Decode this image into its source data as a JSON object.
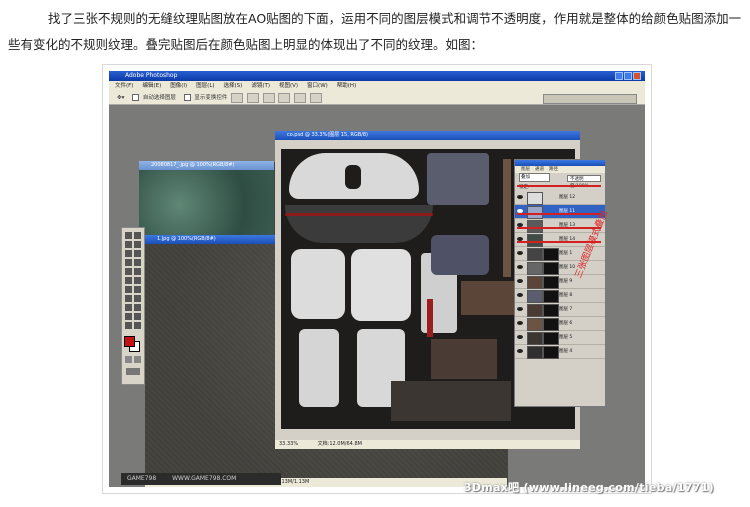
{
  "article": {
    "paragraph": "找了三张不规则的无缝纹理贴图放在AO贴图的下面，运用不同的图层模式和调节不透明度，作用就是整体的给颜色贴图添加一些有变化的不规则纹理。叠完贴图后在颜色贴图上明显的体现出了不同的纹理。如图："
  },
  "photoshop": {
    "app_title": "Adobe Photoshop",
    "menu": [
      "文件(F)",
      "编辑(E)",
      "图像(I)",
      "图层(L)",
      "选择(S)",
      "滤镜(T)",
      "视图(V)",
      "窗口(W)",
      "帮助(H)"
    ],
    "options_bar": {
      "auto_select": "自动选择图层",
      "show_transform": "显示变换控件"
    },
    "documents": [
      {
        "title": "20080817_.jpg @ 100%(RGB/8#)"
      },
      {
        "title": "1.jpg @ 100%(RGB/8#)"
      },
      {
        "title": "co.psd @ 33.3%(图层 15, RGB/8)"
      }
    ],
    "main_status": {
      "zoom": "33.33%",
      "doc_size": "文档:12.0M/64.8M"
    },
    "back_status": "文档:1.13M/1.13M",
    "layers_panel": {
      "tabs": [
        "图层",
        "通道",
        "路径"
      ],
      "blend_mode": "叠加",
      "opacity_label": "不透明度:",
      "opacity_value": "100%",
      "lock_label": "锁定:",
      "layers": [
        {
          "name": "图层 12",
          "selected": false
        },
        {
          "name": "图层 11",
          "selected": true
        },
        {
          "name": "图层 13",
          "selected": false
        },
        {
          "name": "图层 14",
          "selected": false
        },
        {
          "name": "图层 1",
          "selected": false
        },
        {
          "name": "图层 10",
          "selected": false
        },
        {
          "name": "图层 9",
          "selected": false
        },
        {
          "name": "图层 8",
          "selected": false
        },
        {
          "name": "图层 7",
          "selected": false
        },
        {
          "name": "图层 6",
          "selected": false
        },
        {
          "name": "图层 5",
          "selected": false
        },
        {
          "name": "图层 4",
          "selected": false
        }
      ]
    },
    "annotation": "三张图层模式叠加"
  },
  "logo_strip": {
    "brand": "GAME798",
    "url": "WWW.GAME798.COM"
  },
  "watermark": "3Dmax吧 (www.lineeg.com/tieba/1771)",
  "colors": {
    "selection": "#3163c5",
    "annotation": "#d22222",
    "foreground_swatch": "#c41212"
  }
}
